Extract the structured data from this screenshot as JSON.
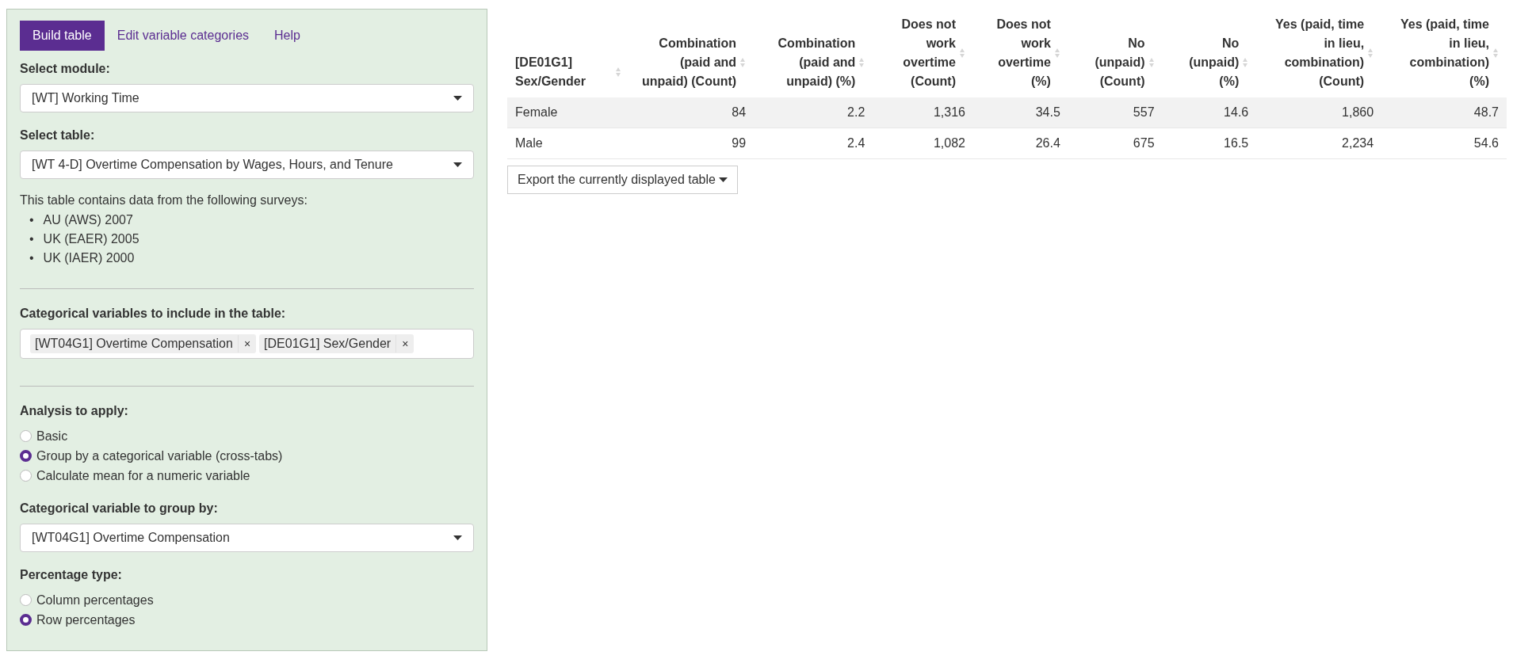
{
  "tabs": [
    {
      "label": "Build table",
      "selected": true
    },
    {
      "label": "Edit variable categories",
      "selected": false
    },
    {
      "label": "Help",
      "selected": false
    }
  ],
  "module_select": {
    "label": "Select module:",
    "value": "[WT] Working Time"
  },
  "table_select": {
    "label": "Select table:",
    "value": "[WT 4-D] Overtime Compensation by Wages, Hours, and Tenure"
  },
  "surveys": {
    "intro": "This table contains data from the following surveys:",
    "items": [
      "AU (AWS) 2007",
      "UK (EAER) 2005",
      "UK (IAER) 2000"
    ],
    "bullet": "•"
  },
  "variables": {
    "label": "Categorical variables to include in the table:",
    "tags": [
      "[WT04G1] Overtime Compensation",
      "[DE01G1] Sex/Gender"
    ],
    "remove_glyph": "×"
  },
  "analysis": {
    "label": "Analysis to apply:",
    "options": [
      {
        "label": "Basic",
        "selected": false
      },
      {
        "label": "Group by a categorical variable (cross-tabs)",
        "selected": true
      },
      {
        "label": "Calculate mean for a numeric variable",
        "selected": false
      }
    ]
  },
  "group_select": {
    "label": "Categorical variable to group by:",
    "value": "[WT04G1] Overtime Compensation"
  },
  "percentage": {
    "label": "Percentage type:",
    "options": [
      {
        "label": "Column percentages",
        "selected": false
      },
      {
        "label": "Row percentages",
        "selected": true
      }
    ]
  },
  "table": {
    "columns": [
      "[DE01G1] Sex/Gender",
      "Combination (paid and unpaid) (Count)",
      "Combination (paid and unpaid) (%)",
      "Does not work overtime (Count)",
      "Does not work overtime (%)",
      "No (unpaid) (Count)",
      "No (unpaid) (%)",
      "Yes (paid, time in lieu, combination) (Count)",
      "Yes (paid, time in lieu, combination) (%)"
    ],
    "rows": [
      [
        "Female",
        "84",
        "2.2",
        "1,316",
        "34.5",
        "557",
        "14.6",
        "1,860",
        "48.7"
      ],
      [
        "Male",
        "99",
        "2.4",
        "1,082",
        "26.4",
        "675",
        "16.5",
        "2,234",
        "54.6"
      ]
    ]
  },
  "export_button": "Export the currently displayed table"
}
